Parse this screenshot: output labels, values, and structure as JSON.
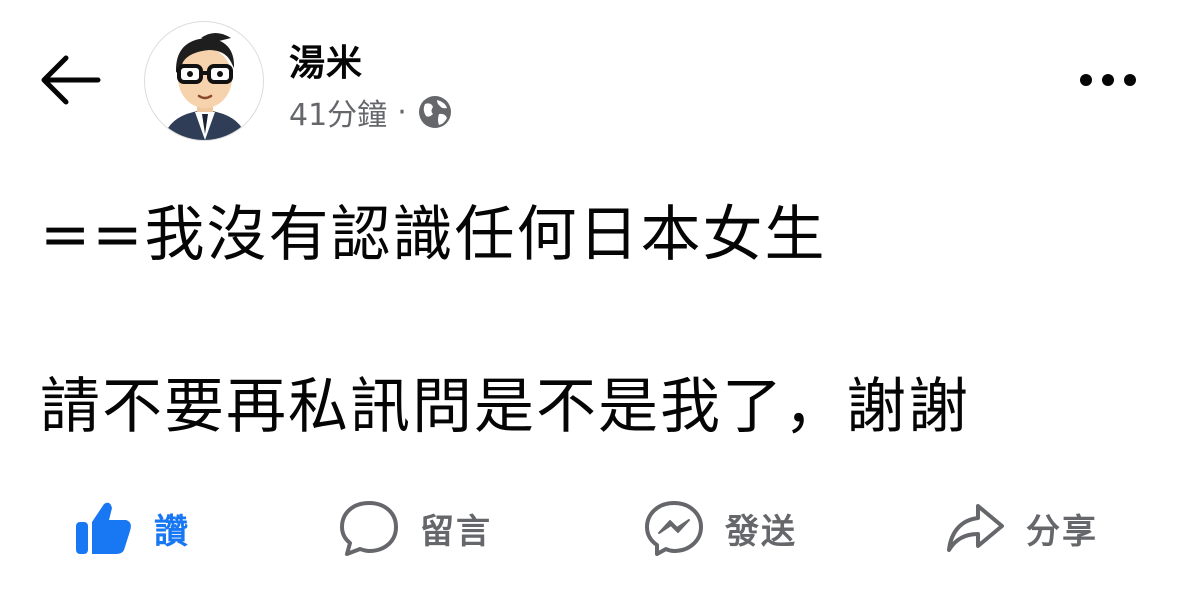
{
  "post": {
    "author": "湯米",
    "time": "41分鐘",
    "separator": "·",
    "privacy_icon": "globe-icon",
    "lines": [
      "==我沒有認識任何日本女生",
      "請不要再私訊問是不是我了，謝謝"
    ]
  },
  "actions": {
    "like": "讚",
    "comment": "留言",
    "send": "發送",
    "share": "分享"
  },
  "colors": {
    "accent": "#1877f2",
    "secondary_text": "#65676b",
    "primary_text": "#050505"
  }
}
